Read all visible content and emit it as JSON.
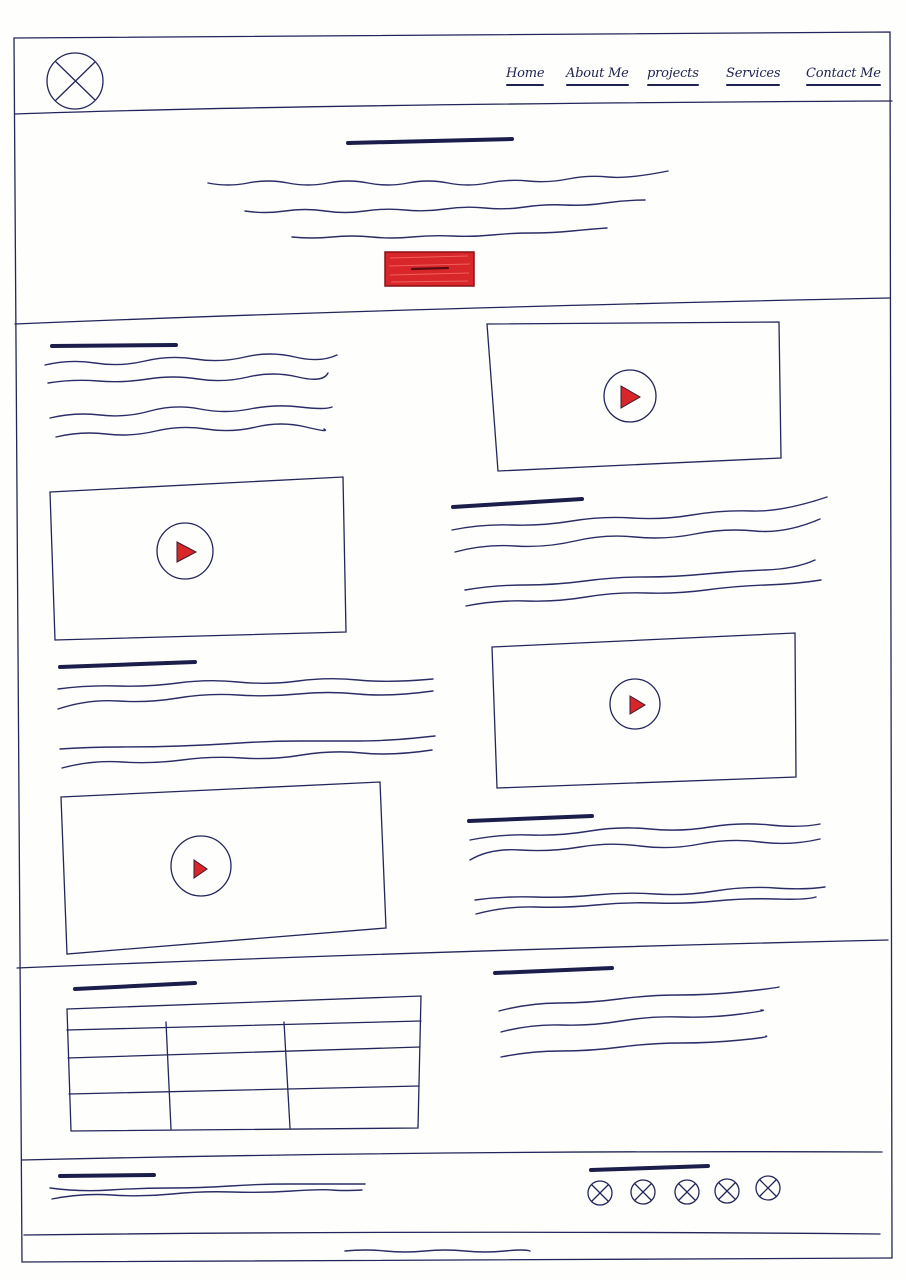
{
  "nav": {
    "items": [
      {
        "label": "Home"
      },
      {
        "label": "About Me"
      },
      {
        "label": "projects"
      },
      {
        "label": "Services"
      },
      {
        "label": "Contact Me"
      }
    ]
  },
  "colors": {
    "ink": "#1f2250",
    "accent": "#d9262a",
    "paper": "#fefefc"
  },
  "icons": {
    "logo": "logo-placeholder-icon",
    "video": "play-icon",
    "social": "social-placeholder-icon"
  }
}
